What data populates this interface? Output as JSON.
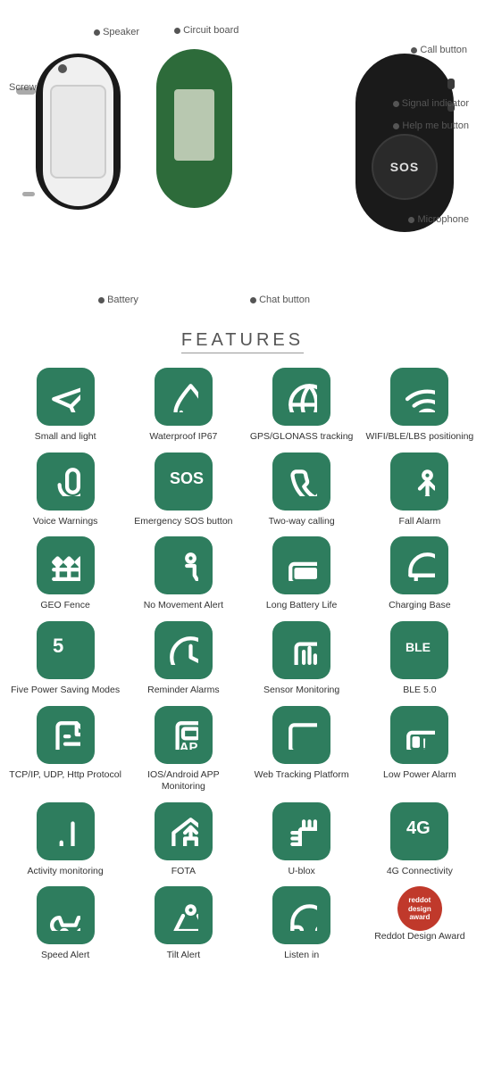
{
  "diagram": {
    "labels": {
      "speaker": "Speaker",
      "circuit_board": "Circuit board",
      "call_button": "Call button",
      "screw": "Screw",
      "signal_indicator": "Signal indicator",
      "help_me_button": "Help me button",
      "microphone": "Microphone",
      "battery": "Battery",
      "chat_button": "Chat button"
    }
  },
  "features_title": "FEATURES",
  "features": [
    {
      "id": "small-light",
      "label": "Small and light",
      "icon": "send"
    },
    {
      "id": "waterproof",
      "label": "Waterproof IP67",
      "icon": "droplets"
    },
    {
      "id": "gps",
      "label": "GPS/GLONASS tracking",
      "icon": "globe"
    },
    {
      "id": "wifi-ble",
      "label": "WIFI/BLE/LBS positioning",
      "icon": "wifi-signal"
    },
    {
      "id": "voice-warnings",
      "label": "Voice Warnings",
      "icon": "mic"
    },
    {
      "id": "sos",
      "label": "Emergency SOS button",
      "icon": "sos"
    },
    {
      "id": "two-way-calling",
      "label": "Two-way calling",
      "icon": "phone"
    },
    {
      "id": "fall-alarm",
      "label": "Fall Alarm",
      "icon": "fall"
    },
    {
      "id": "geo-fence",
      "label": "GEO Fence",
      "icon": "fence"
    },
    {
      "id": "no-movement",
      "label": "No Movement Alert",
      "icon": "person-sit"
    },
    {
      "id": "battery-life",
      "label": "Long Battery Life",
      "icon": "battery-full"
    },
    {
      "id": "charging-base",
      "label": "Charging Base",
      "icon": "helmet"
    },
    {
      "id": "power-modes",
      "label": "Five Power Saving Modes",
      "icon": "five"
    },
    {
      "id": "reminder-alarms",
      "label": "Reminder Alarms",
      "icon": "clock"
    },
    {
      "id": "sensor-monitoring",
      "label": "Sensor Monitoring",
      "icon": "sensor"
    },
    {
      "id": "ble50",
      "label": "BLE 5.0",
      "icon": "ble"
    },
    {
      "id": "tcp-ip",
      "label": "TCP/IP, UDP, Http Protocol",
      "icon": "files"
    },
    {
      "id": "app-monitoring",
      "label": "IOS/Android APP Monitoring",
      "icon": "app"
    },
    {
      "id": "web-tracking",
      "label": "Web Tracking Platform",
      "icon": "monitor"
    },
    {
      "id": "low-power",
      "label": "Low Power Alarm",
      "icon": "battery-low"
    },
    {
      "id": "activity",
      "label": "Activity monitoring",
      "icon": "chart-bar"
    },
    {
      "id": "fota",
      "label": "FOTA",
      "icon": "upload-home"
    },
    {
      "id": "ublox",
      "label": "U-blox",
      "icon": "chip"
    },
    {
      "id": "4g",
      "label": "4G Connectivity",
      "icon": "4g"
    },
    {
      "id": "speed-alert",
      "label": "Speed Alert",
      "icon": "car-speed"
    },
    {
      "id": "tilt-alert",
      "label": "Tilt Alert",
      "icon": "tilt"
    },
    {
      "id": "listen-in",
      "label": "Listen in",
      "icon": "headphones"
    },
    {
      "id": "reddot",
      "label": "Reddot Design Award",
      "icon": "reddot"
    }
  ]
}
